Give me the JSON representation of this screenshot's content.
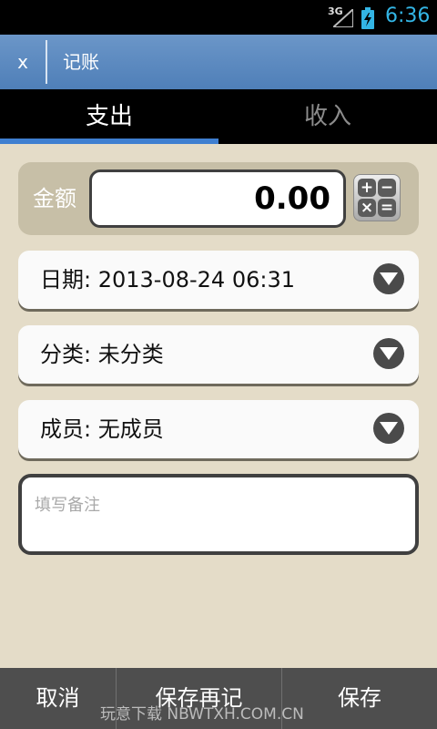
{
  "status_bar": {
    "network": "3G",
    "time": "6:36",
    "icons": [
      "signal-icon",
      "battery-charging-icon"
    ]
  },
  "action_bar": {
    "close_label": "x",
    "title": "记账"
  },
  "tabs": [
    {
      "label": "支出",
      "selected": true
    },
    {
      "label": "收入",
      "selected": false
    }
  ],
  "amount": {
    "label": "金额",
    "value": "0.00",
    "calculator_icon": "calculator-icon",
    "calculator_keys": [
      "+",
      "−",
      "×",
      "="
    ]
  },
  "fields": {
    "date": "日期: 2013-08-24 06:31",
    "category": "分类: 未分类",
    "member": "成员: 无成员"
  },
  "note": {
    "placeholder": "填写备注"
  },
  "bottom_bar": {
    "cancel": "取消",
    "save_and_continue": "保存再记",
    "save": "保存",
    "watermark": "玩意下载 NBWTXH.COM.CN"
  },
  "colors": {
    "background": "#e4dcc8",
    "action_bar": "#5b88c0",
    "tab_indicator": "#3f7fd0",
    "time": "#33b5e5"
  }
}
